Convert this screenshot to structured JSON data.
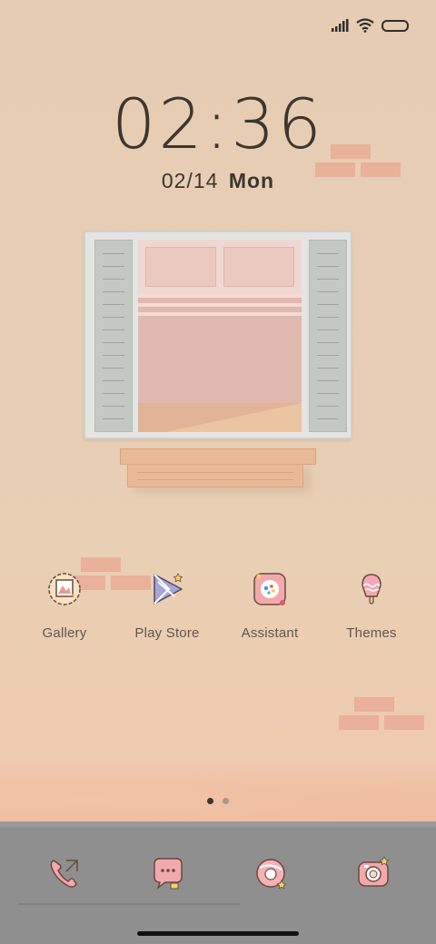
{
  "status_bar": {
    "icons": [
      "signal-icon",
      "wifi-icon",
      "battery-icon"
    ]
  },
  "clock": {
    "time": "02:36",
    "date": "02/14",
    "day": "Mon"
  },
  "apps": [
    {
      "label": "Gallery",
      "icon": "gallery-icon"
    },
    {
      "label": "Play Store",
      "icon": "play-store-icon"
    },
    {
      "label": "Assistant",
      "icon": "assistant-icon"
    },
    {
      "label": "Themes",
      "icon": "themes-icon"
    }
  ],
  "page_indicator": {
    "pages": 2,
    "current": 1
  },
  "dock": [
    {
      "icon": "phone-icon"
    },
    {
      "icon": "messages-icon"
    },
    {
      "icon": "browser-icon"
    },
    {
      "icon": "camera-icon"
    }
  ],
  "colors": {
    "wallpaper": "#e6ccb2",
    "brick": "#e9b09a",
    "dock": "#8f8f8f",
    "text": "#3b3630"
  }
}
